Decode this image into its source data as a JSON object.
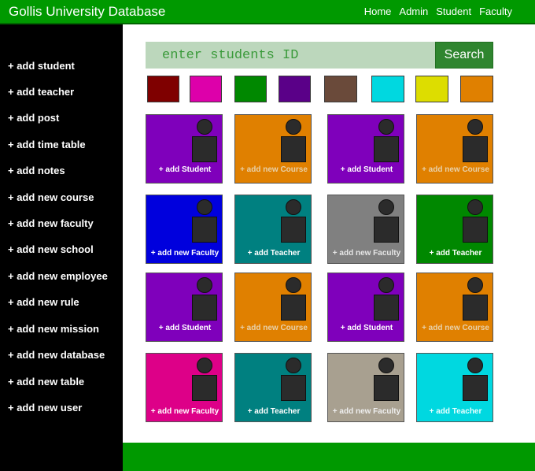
{
  "header": {
    "title": "Gollis University Database",
    "nav": [
      "Home",
      "Admin",
      "Student",
      "Faculty"
    ]
  },
  "sidebar": {
    "items": [
      "+ add student",
      "+ add teacher",
      "+ add post",
      "+ add time table",
      "+ add notes",
      "+ add new course",
      "+ add new faculty",
      "+ add new school",
      "+ add new employee",
      "+ add new rule",
      "+ add new mission",
      "+ add new database",
      "+ add new table",
      "+ add new user"
    ]
  },
  "search": {
    "placeholder": "enter students ID",
    "button_label": "Search"
  },
  "swatches": [
    "#7f0000",
    "#dd00aa",
    "#008800",
    "#5a0088",
    "#6a4a3a",
    "#00d8e0",
    "#dddd00",
    "#e08000"
  ],
  "cards": [
    [
      {
        "label": "+ add Student",
        "bg": "#7f00bb",
        "fg": "#ffffff"
      },
      {
        "label": "+ add new Course",
        "bg": "#e08000",
        "fg": "#e8d0a8"
      },
      {
        "label": "+ add Student",
        "bg": "#7f00bb",
        "fg": "#ffffff"
      },
      {
        "label": "+ add new Course",
        "bg": "#e08000",
        "fg": "#e8d0a8"
      }
    ],
    [
      {
        "label": "+ add new Faculty",
        "bg": "#0000dd",
        "fg": "#ffffff"
      },
      {
        "label": "+ add Teacher",
        "bg": "#008080",
        "fg": "#ffffff"
      },
      {
        "label": "+ add new Faculty",
        "bg": "#808080",
        "fg": "#e6e6e6"
      },
      {
        "label": "+ add Teacher",
        "bg": "#008800",
        "fg": "#ffffff"
      }
    ],
    [
      {
        "label": "+ add Student",
        "bg": "#7f00bb",
        "fg": "#ffffff"
      },
      {
        "label": "+ add new Course",
        "bg": "#e08000",
        "fg": "#e8d0a8"
      },
      {
        "label": "+ add Student",
        "bg": "#7f00bb",
        "fg": "#ffffff"
      },
      {
        "label": "+ add new Course",
        "bg": "#e08000",
        "fg": "#e8d0a8"
      }
    ],
    [
      {
        "label": "+ add new Faculty",
        "bg": "#dd0088",
        "fg": "#ffffff"
      },
      {
        "label": "+ add Teacher",
        "bg": "#008080",
        "fg": "#ffffff"
      },
      {
        "label": "+ add new Faculty",
        "bg": "#a8a090",
        "fg": "#eeeeee"
      },
      {
        "label": "+ add Teacher",
        "bg": "#00d8e0",
        "fg": "#e8ffff"
      }
    ]
  ]
}
